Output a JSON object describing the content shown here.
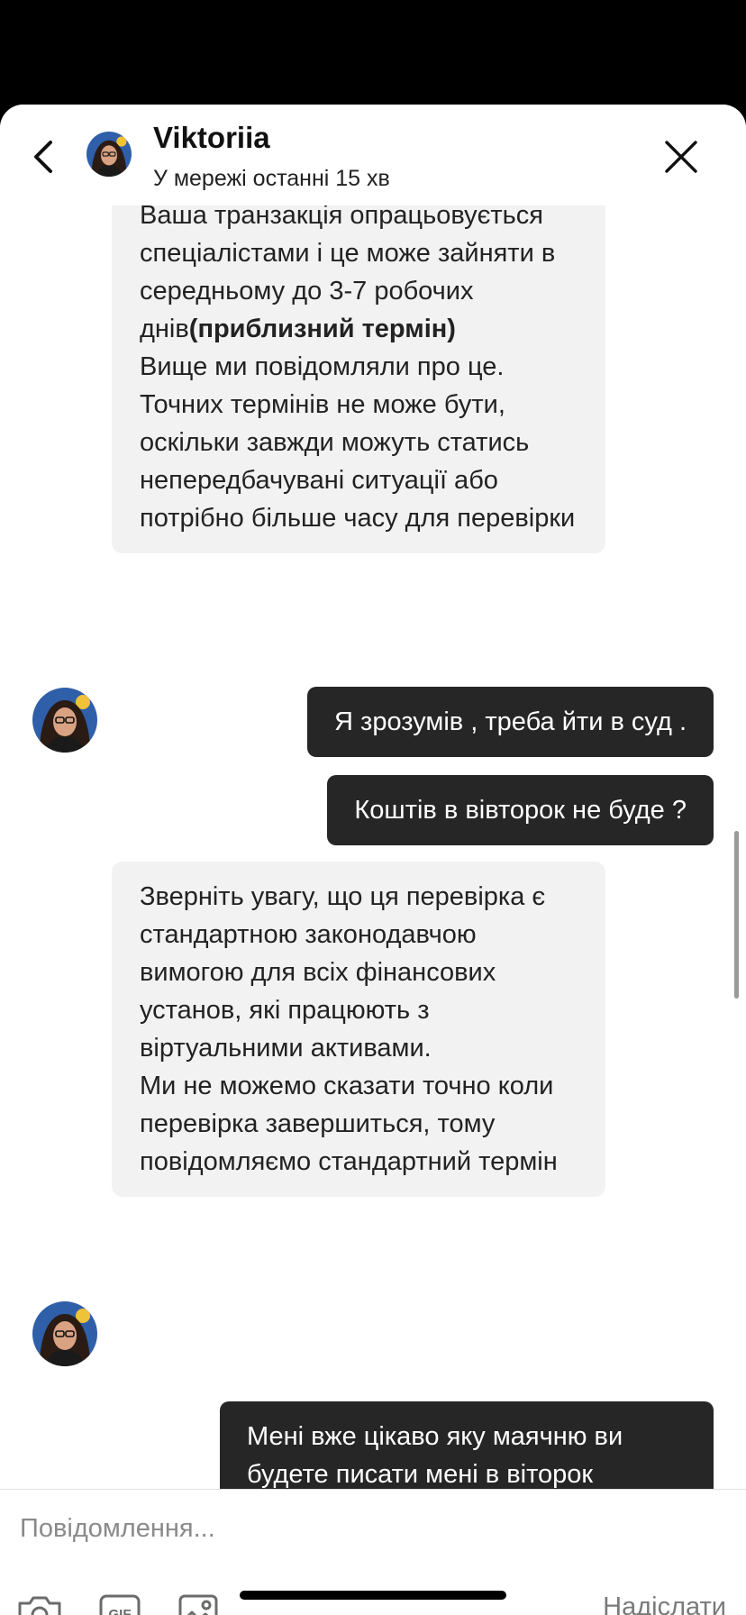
{
  "header": {
    "name": "Viktoriia",
    "status": "У мережі останні 15 хв"
  },
  "messages": [
    {
      "side": "in",
      "paragraphs": [
        "Ваша транзакція опрацьовується спеціалістами і це може зайняти в середньому до 3-7 робочих днів",
        "(приблизний термін)",
        "Вище ми повідомляли про це. Точних термінів не може бути, оскільки завжди можуть статись непередбачувані ситуації або потрібно більше часу для перевірки"
      ]
    },
    {
      "side": "out",
      "text": "Я зрозумів , треба йти в суд ."
    },
    {
      "side": "out",
      "text": "Коштів в вівторок не буде ?"
    },
    {
      "side": "in",
      "paragraphs": [
        "Зверніть увагу, що ця перевірка є стандартною законодавчою вимогою для всіх фінансових установ, які працюють з віртуальними активами.",
        "Ми не можемо сказати точно коли перевірка завершиться, тому повідомляємо стандартний термін"
      ]
    },
    {
      "side": "out",
      "text": "Мені вже цікаво яку маячню ви будете писати мені в віторок"
    }
  ],
  "composer": {
    "placeholder": "Повідомлення...",
    "send_label": "Надіслати",
    "icons": [
      "camera-icon",
      "gif-icon",
      "image-icon"
    ]
  },
  "colors": {
    "outgoing_bubble": "#262626",
    "incoming_bubble": "#f2f2f2",
    "send_text": "#7a7a7a"
  }
}
